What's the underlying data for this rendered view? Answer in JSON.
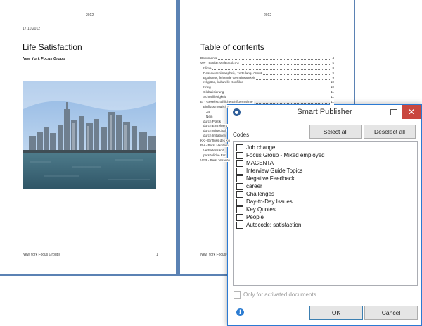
{
  "document": {
    "left_page": {
      "header_year": "2012",
      "date": "17.10.2012",
      "title": "Life Satisfaction",
      "subtitle": "New York Focus Group",
      "footer_left": "New York Focus Groups",
      "footer_right": "1"
    },
    "right_page": {
      "header_year": "2012",
      "toc_title": "Table of contents",
      "toc": [
        {
          "text": "Documents",
          "page": "4"
        },
        {
          "text": "WP - Größte Weltprobleme",
          "page": "5"
        },
        {
          "text": "Klima",
          "page": "8"
        },
        {
          "text": "Ressourcenknappheit, -verteilung, Armut",
          "page": "9"
        },
        {
          "text": "Egoismus, fehlende Gemeinsamkeit",
          "page": "9"
        },
        {
          "text": "religiöse, kulturelle Konflikte",
          "page": "10"
        },
        {
          "text": "Krieg",
          "page": "10"
        },
        {
          "text": "Globalisierung",
          "page": "11"
        },
        {
          "text": "Schnelllebigkeit",
          "page": "11"
        },
        {
          "text": "EI - Gesellschaftliche Einflussnahme",
          "page": "11"
        },
        {
          "text": "Einfluss möglich?",
          "page": ""
        },
        {
          "text": "Ja",
          "page": ""
        },
        {
          "text": "Nein",
          "page": ""
        },
        {
          "text": "durch Politik",
          "page": ""
        },
        {
          "text": "durch Einzelpers",
          "page": ""
        },
        {
          "text": "durch Wirtschaft",
          "page": ""
        },
        {
          "text": "durch Initiativen",
          "page": ""
        },
        {
          "text": "KK - Einfluss des Ko",
          "page": ""
        },
        {
          "text": "PH - Pers. Handeln",
          "page": ""
        },
        {
          "text": "Verhaltensänd",
          "page": ""
        },
        {
          "text": "persönliche Ent",
          "page": ""
        },
        {
          "text": "VER - Pers. Verantw",
          "page": ""
        }
      ],
      "footer_left": "New York Focus Groups",
      "footer_right": "2"
    }
  },
  "dialog": {
    "title": "Smart Publisher",
    "close_glyph": "✕",
    "codes_label": "Codes",
    "select_all": "Select all",
    "deselect_all": "Deselect all",
    "codes": [
      {
        "label": "Job change",
        "checked": false
      },
      {
        "label": "Focus Group - Mixed employed",
        "checked": false
      },
      {
        "label": "MAGENTA",
        "checked": false
      },
      {
        "label": "Interview Guide Topics",
        "checked": false
      },
      {
        "label": "Negative Feedback",
        "checked": false
      },
      {
        "label": "career",
        "checked": false
      },
      {
        "label": "Challenges",
        "checked": false
      },
      {
        "label": "Day-to-Day Issues",
        "checked": false
      },
      {
        "label": "Key Quotes",
        "checked": false
      },
      {
        "label": "People",
        "checked": false
      },
      {
        "label": "Autocode: satisfaction",
        "checked": false
      }
    ],
    "only_activated": "Only for activated documents",
    "info_glyph": "i",
    "ok": "OK",
    "cancel": "Cancel"
  }
}
